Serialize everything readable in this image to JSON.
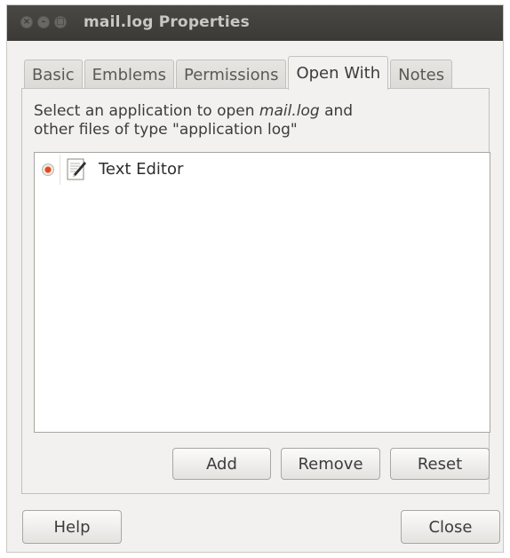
{
  "window": {
    "title": "mail.log Properties"
  },
  "tabs": [
    {
      "label": "Basic"
    },
    {
      "label": "Emblems"
    },
    {
      "label": "Permissions"
    },
    {
      "label": "Open With"
    },
    {
      "label": "Notes"
    }
  ],
  "active_tab": "Open With",
  "open_with": {
    "desc_prefix": "Select an application to open ",
    "desc_filename": "mail.log",
    "desc_mid": " and",
    "desc_line2": "other files of type \"application log\"",
    "applications": [
      {
        "name": "Text Editor",
        "selected": true,
        "icon": "text-editor-icon"
      }
    ],
    "buttons": {
      "add": "Add",
      "remove": "Remove",
      "reset": "Reset"
    }
  },
  "footer": {
    "help": "Help",
    "close": "Close"
  },
  "colors": {
    "titlebar": "#3b3a36",
    "window_bg": "#f2f1f0",
    "radio_accent": "#df4a1e"
  }
}
